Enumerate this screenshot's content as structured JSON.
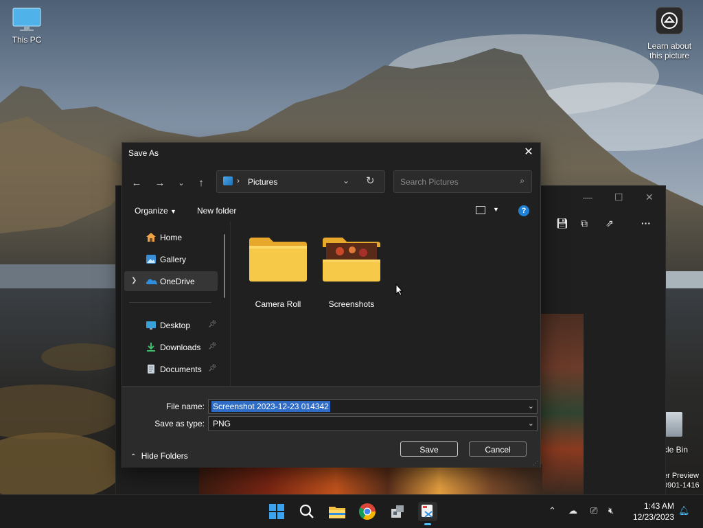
{
  "desktop": {
    "this_pc_label": "This PC",
    "learn_label_line1": "Learn about",
    "learn_label_line2": "this picture",
    "recycle_label": "cle Bin",
    "preview_line1": "er Preview",
    "preview_line2": "0901-1416"
  },
  "dialog": {
    "title": "Save As",
    "address_location": "Pictures",
    "search_placeholder": "Search Pictures",
    "organize_label": "Organize",
    "new_folder_label": "New folder",
    "help_label": "?",
    "nav_items": [
      {
        "label": "Home",
        "icon": "home-icon"
      },
      {
        "label": "Gallery",
        "icon": "gallery-icon"
      },
      {
        "label": "OneDrive",
        "icon": "onedrive-icon"
      },
      {
        "label": "Desktop",
        "icon": "desktop-icon"
      },
      {
        "label": "Downloads",
        "icon": "downloads-icon"
      },
      {
        "label": "Documents",
        "icon": "documents-icon"
      }
    ],
    "folders": [
      {
        "label": "Camera Roll"
      },
      {
        "label": "Screenshots"
      }
    ],
    "file_name_label": "File name:",
    "file_name_value": "Screenshot 2023-12-23 014342",
    "save_type_label": "Save as type:",
    "save_type_value": "PNG",
    "save_button": "Save",
    "cancel_button": "Cancel",
    "hide_folders": "Hide Folders"
  },
  "taskbar": {
    "time": "1:43 AM",
    "date": "12/23/2023"
  },
  "colors": {
    "accent": "#2f6cc6",
    "help_blue": "#1f82d8",
    "folder_yellow": "#f5c542"
  }
}
